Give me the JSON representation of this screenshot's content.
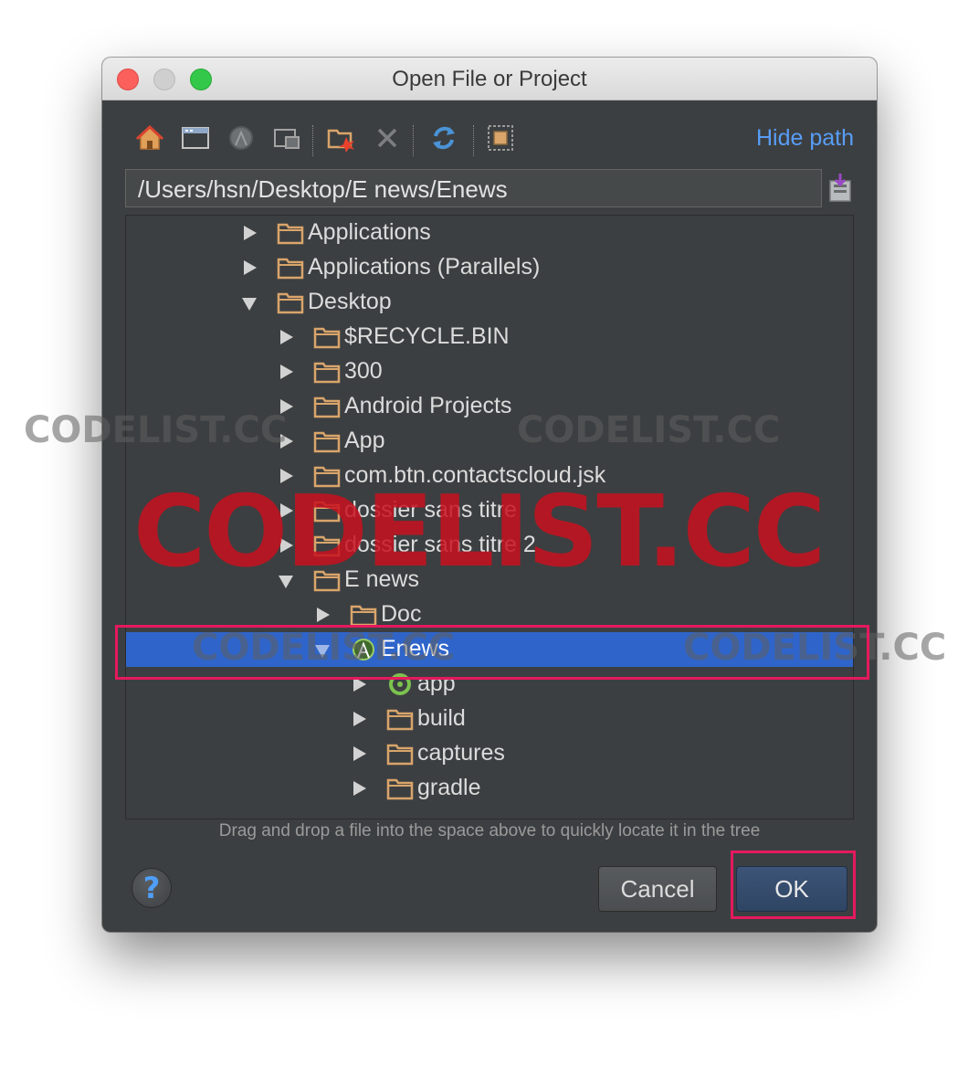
{
  "window": {
    "title": "Open File or Project"
  },
  "toolbar": {
    "icons": [
      "home-icon",
      "desktop-icon",
      "android-icon",
      "new-folder-icon",
      "delete-icon",
      "refresh-icon",
      "show-hidden-icon"
    ],
    "hide_path": "Hide path"
  },
  "path": {
    "value": "/Users/hsn/Desktop/E news/Enews"
  },
  "tree": {
    "rows": [
      {
        "label": "Applications"
      },
      {
        "label": "Applications (Parallels)"
      },
      {
        "label": "Desktop"
      },
      {
        "label": "$RECYCLE.BIN"
      },
      {
        "label": "300"
      },
      {
        "label": "Android Projects"
      },
      {
        "label": "App"
      },
      {
        "label": "com.btn.contactscloud.jsk"
      },
      {
        "label": "dossier sans titre"
      },
      {
        "label": "dossier sans titre 2"
      },
      {
        "label": "E news"
      },
      {
        "label": "Doc"
      },
      {
        "label": "Enews"
      },
      {
        "label": "app"
      },
      {
        "label": "build"
      },
      {
        "label": "captures"
      },
      {
        "label": "gradle"
      }
    ]
  },
  "hint": "Drag and drop a file into the space above to quickly locate it in the tree",
  "help": {
    "symbol": "?"
  },
  "buttons": {
    "cancel": "Cancel",
    "ok": "OK"
  },
  "watermarks": {
    "small": "CODELIST.CC",
    "big": "CODELIST.CC"
  },
  "colors": {
    "accent": "#589df6",
    "selection": "#2f65ca",
    "folder": "#d9a56b",
    "highlight": "#e5195e"
  }
}
